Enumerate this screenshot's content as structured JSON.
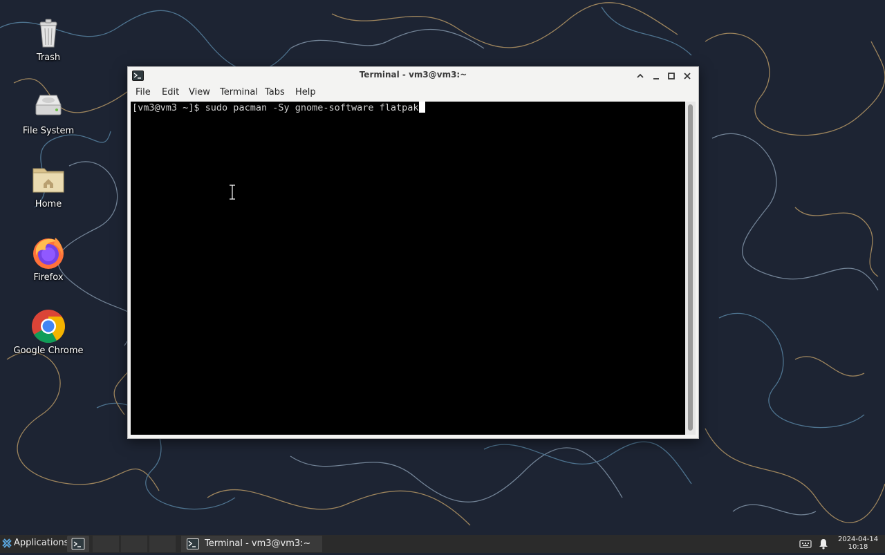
{
  "desktop": {
    "icons": [
      {
        "label": "Trash",
        "icon": "trash-icon"
      },
      {
        "label": "File System",
        "icon": "drive-icon"
      },
      {
        "label": "Home",
        "icon": "home-folder-icon"
      },
      {
        "label": "Firefox",
        "icon": "firefox-icon"
      },
      {
        "label": "Google Chrome",
        "icon": "chrome-icon"
      }
    ]
  },
  "window": {
    "title": "Terminal - vm3@vm3:~",
    "menu": [
      "File",
      "Edit",
      "View",
      "Terminal",
      "Tabs",
      "Help"
    ],
    "terminal": {
      "prompt": "[vm3@vm3 ~]$ ",
      "command": "sudo pacman -Sy gnome-software flatpak"
    }
  },
  "taskbar": {
    "applications_label": "Applications",
    "task_label": "Terminal - vm3@vm3:~",
    "clock_date": "2024-04-14",
    "clock_time": "10:18"
  },
  "colors": {
    "wallpaper": "#1d2433",
    "terminal_bg": "#000000",
    "taskbar_bg": "#2b2b2b"
  }
}
